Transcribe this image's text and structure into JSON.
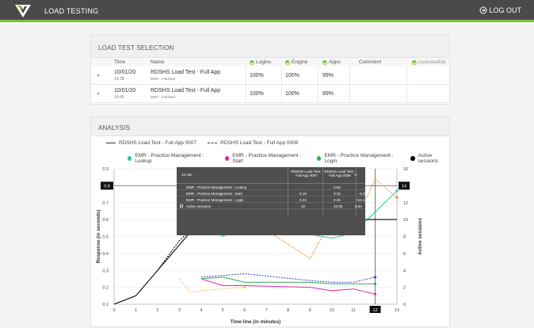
{
  "header": {
    "title": "LOAD TESTING",
    "logout_label": "LOG OUT"
  },
  "selection": {
    "title": "LOAD TEST SELECTION",
    "columns": {
      "time": "Time",
      "name": "Name",
      "logins": "Logins",
      "engine": "Engine",
      "apps": "Apps",
      "comment": "Comment",
      "successful": "(successful)"
    },
    "rows": [
      {
        "date": "10/01/20",
        "time": "14:28",
        "name": "RDSHS Load Test - Full App",
        "sub": "0006 - Finished",
        "logins": "100%",
        "engine": "100%",
        "apps": "99%"
      },
      {
        "date": "10/01/20",
        "time": "14:45",
        "name": "RDSHS Load Test - Full App",
        "sub": "0007 - Finished",
        "logins": "100%",
        "engine": "100%",
        "apps": "99%"
      }
    ]
  },
  "analysis": {
    "title": "ANALYSIS",
    "run_legend": {
      "solid": "RDSHS Load Test - Full App 0007",
      "dashed": "RDSHS Load Test - Full App 0006"
    },
    "series_legend": [
      {
        "label": "EMR - Practice Management : Lookup",
        "color": "#2ec4a5"
      },
      {
        "label": "EMR - Practice Management : Start",
        "color": "#e4259c"
      },
      {
        "label": "EMR - Practice Management : Login",
        "color": "#33a852"
      },
      {
        "label": "Active sessions",
        "color": "#000000"
      }
    ],
    "tooltip": {
      "header": "12 min",
      "col1": "RDSHS Load Test - Full App 0007",
      "col2": "RDSHS Load Test - Full App 0006",
      "col3": "%",
      "rows": [
        {
          "label": "EMR - Practice Management : Lookup",
          "v1": "",
          "v2": "0.84",
          "v3": ""
        },
        {
          "label": "EMR - Practice Management : Start",
          "v1": "0.16",
          "v2": "0.15",
          "v3": "-6.25"
        },
        {
          "label": "EMR - Practice Management : Login",
          "v1": "0.22",
          "v2": "0.26",
          "v3": "+18.18"
        },
        {
          "label": "Active sessions",
          "v1": "10",
          "v2": "10.00",
          "v3": "0.00"
        }
      ]
    }
  },
  "chart_data": {
    "type": "line",
    "xlabel": "Time line (in minutes)",
    "ylabel": "Response (in seconds)",
    "y2label": "Active sessions",
    "xlim": [
      0,
      13
    ],
    "ylim": [
      0.1,
      0.9
    ],
    "y2lim": [
      0,
      16
    ],
    "x_ticks": [
      "0",
      "1",
      "2",
      "3",
      "4",
      "5",
      "6",
      "7",
      "8",
      "9",
      "10",
      "11",
      "12",
      "13"
    ],
    "y_ticks": [
      "0.1",
      "0.2",
      "0.3",
      "0.4",
      "0.5",
      "0.6",
      "0.7",
      "0.8",
      "0.9"
    ],
    "y2_ticks": [
      "0",
      "2",
      "4",
      "6",
      "8",
      "10",
      "12",
      "14",
      "16"
    ],
    "crosshair": {
      "x": "12",
      "y": "0.8",
      "y2": "14"
    },
    "series": [
      {
        "name": "EMR - Practice Management : Lookup",
        "run": "0007",
        "color": "#2ec4a5",
        "dash": false,
        "axis": "left",
        "x": [
          4,
          5,
          6,
          10,
          11,
          13
        ],
        "y": [
          0.59,
          0.5,
          0.58,
          0.49,
          0.52,
          0.77
        ]
      },
      {
        "name": "EMR - Practice Management : Lookup",
        "run": "0006",
        "color": "#f0883a",
        "dash": true,
        "axis": "left",
        "x": [
          5.5,
          6,
          9,
          10,
          11,
          12,
          13
        ],
        "y": [
          0.68,
          0.62,
          0.37,
          0.6,
          0.56,
          0.84,
          0.73
        ]
      },
      {
        "name": "EMR - Practice Management : Start",
        "run": "0007",
        "color": "#e4259c",
        "dash": false,
        "axis": "left",
        "x": [
          4,
          5,
          6,
          9,
          10,
          11,
          12
        ],
        "y": [
          0.25,
          0.21,
          0.21,
          0.2,
          0.18,
          0.19,
          0.16
        ]
      },
      {
        "name": "EMR - Practice Management : Start",
        "run": "0006",
        "color": "#f0c060",
        "dash": true,
        "axis": "left",
        "x": [
          3,
          3.5,
          4,
          6
        ],
        "y": [
          0.25,
          0.17,
          0.18,
          0.2
        ]
      },
      {
        "name": "EMR - Practice Management : Login",
        "run": "0007",
        "color": "#33a852",
        "dash": false,
        "axis": "left",
        "x": [
          4,
          5,
          6,
          9,
          10,
          11,
          12
        ],
        "y": [
          0.25,
          0.26,
          0.23,
          0.23,
          0.22,
          0.22,
          0.22
        ]
      },
      {
        "name": "EMR - Practice Management : Login",
        "run": "0006",
        "color": "#3838d0",
        "dash": true,
        "axis": "left",
        "x": [
          4,
          5,
          6,
          9,
          10,
          11,
          12
        ],
        "y": [
          0.26,
          0.27,
          0.28,
          0.24,
          0.23,
          0.23,
          0.26
        ]
      },
      {
        "name": "Active sessions",
        "run": "0007",
        "color": "#000000",
        "dash": false,
        "axis": "right",
        "x": [
          0,
          1,
          2,
          3,
          4,
          4.5,
          5,
          6,
          7,
          8,
          9,
          10,
          11,
          12,
          13
        ],
        "y": [
          0,
          1,
          4,
          7,
          10,
          10,
          10,
          10,
          10,
          10,
          10,
          10,
          10,
          10,
          10
        ]
      },
      {
        "name": "Active sessions",
        "run": "0006",
        "color": "#000000",
        "dash": true,
        "axis": "right",
        "x": [
          2,
          3,
          3.5,
          4,
          5.5,
          6
        ],
        "y": [
          4,
          7.5,
          8.7,
          9.7,
          10.3,
          10.3
        ]
      }
    ]
  }
}
